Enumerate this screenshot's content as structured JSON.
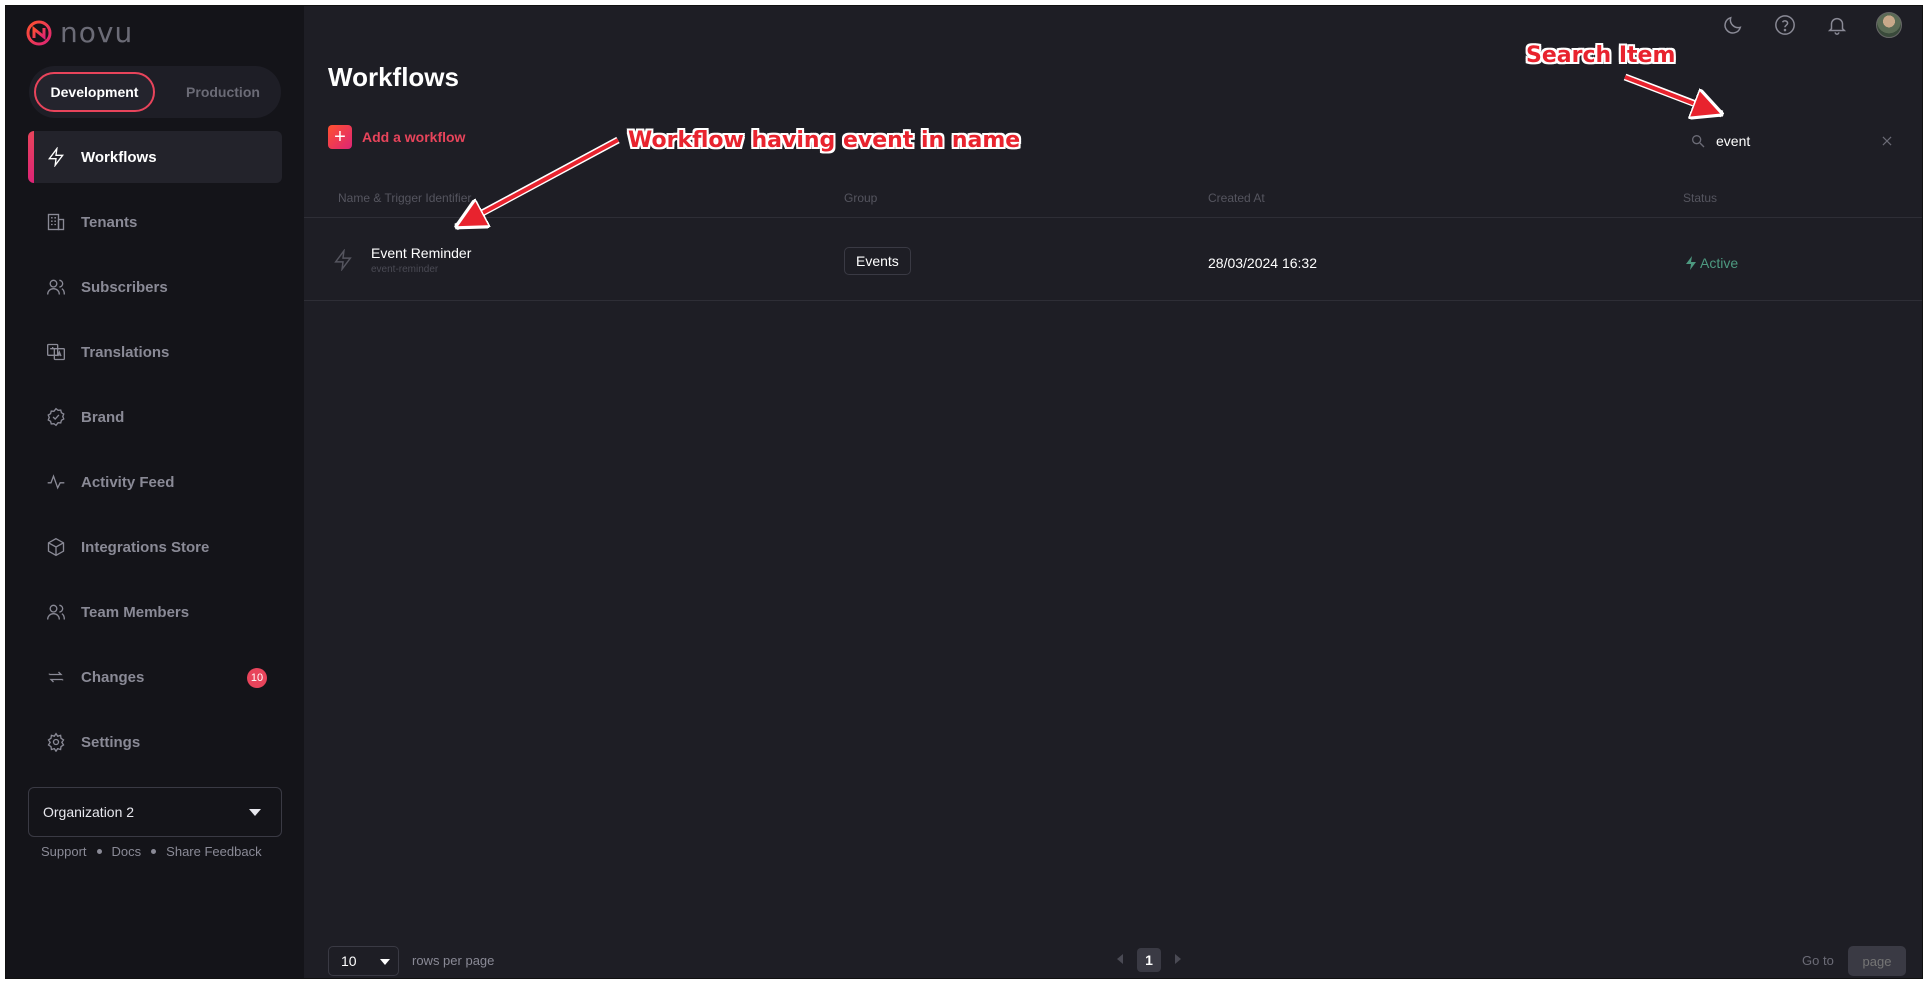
{
  "brand": {
    "name": "novu",
    "accent": "#e8445b"
  },
  "environment": {
    "options": [
      "Development",
      "Production"
    ],
    "selected": "Development"
  },
  "sidebar": {
    "items": [
      {
        "label": "Workflows",
        "icon": "bolt-icon",
        "active": true
      },
      {
        "label": "Tenants",
        "icon": "building-icon"
      },
      {
        "label": "Subscribers",
        "icon": "users-icon"
      },
      {
        "label": "Translations",
        "icon": "translate-icon"
      },
      {
        "label": "Brand",
        "icon": "badge-check-icon"
      },
      {
        "label": "Activity Feed",
        "icon": "activity-icon"
      },
      {
        "label": "Integrations Store",
        "icon": "box-icon"
      },
      {
        "label": "Team Members",
        "icon": "team-icon"
      },
      {
        "label": "Changes",
        "icon": "sync-icon",
        "badge": "10"
      },
      {
        "label": "Settings",
        "icon": "gear-icon"
      }
    ],
    "organization": "Organization 2",
    "footer_links": [
      "Support",
      "Docs",
      "Share Feedback"
    ]
  },
  "header": {
    "icons": [
      "moon-icon",
      "help-icon",
      "bell-icon",
      "avatar"
    ]
  },
  "main": {
    "title": "Workflows",
    "add_label": "Add a workflow",
    "search": {
      "value": "event"
    },
    "columns": [
      "Name & Trigger Identifier",
      "Group",
      "Created At",
      "Status"
    ],
    "rows": [
      {
        "name": "Event Reminder",
        "identifier": "event-reminder",
        "group": "Events",
        "created_at": "28/03/2024 16:32",
        "status": "Active"
      }
    ]
  },
  "pagination": {
    "rows_per_page": "10",
    "rows_label": "rows per page",
    "current_page": "1",
    "goto_label": "Go to",
    "goto_placeholder": "page"
  },
  "annotations": {
    "search": "Search Item",
    "workflow": "Workflow having event in name"
  }
}
